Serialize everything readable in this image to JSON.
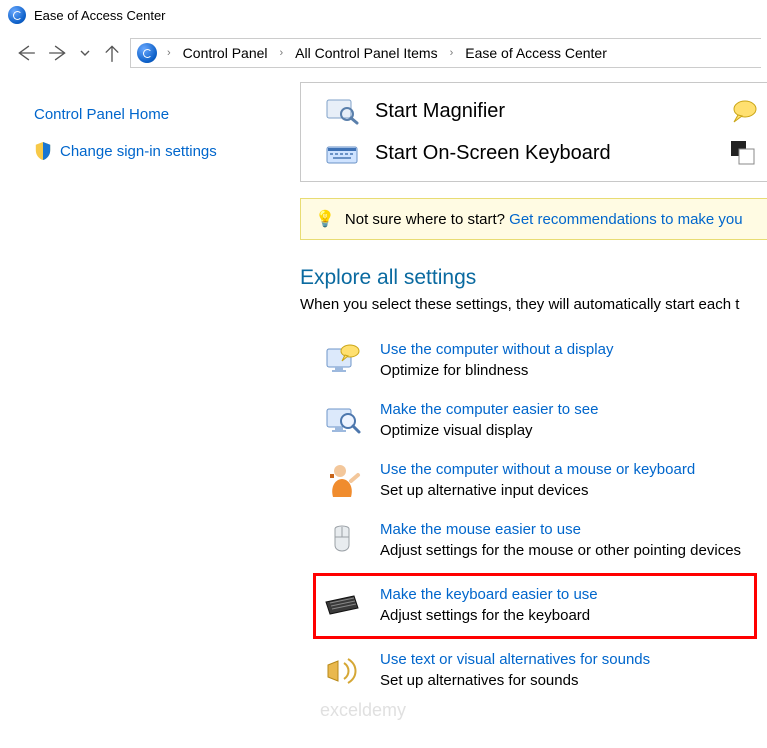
{
  "window_title": "Ease of Access Center",
  "breadcrumb": [
    "Control Panel",
    "All Control Panel Items",
    "Ease of Access Center"
  ],
  "sidebar": {
    "home": "Control Panel Home",
    "signin": "Change sign-in settings"
  },
  "quick": {
    "magnifier": "Start Magnifier",
    "osk": "Start On-Screen Keyboard"
  },
  "info": {
    "lead": "Not sure where to start? ",
    "link": "Get recommendations to make you"
  },
  "explore": {
    "heading": "Explore all settings",
    "sub": "When you select these settings, they will automatically start each t",
    "items": [
      {
        "title": "Use the computer without a display",
        "desc": "Optimize for blindness"
      },
      {
        "title": "Make the computer easier to see",
        "desc": "Optimize visual display"
      },
      {
        "title": "Use the computer without a mouse or keyboard",
        "desc": "Set up alternative input devices"
      },
      {
        "title": "Make the mouse easier to use",
        "desc": "Adjust settings for the mouse or other pointing devices"
      },
      {
        "title": "Make the keyboard easier to use",
        "desc": "Adjust settings for the keyboard"
      },
      {
        "title": "Use text or visual alternatives for sounds",
        "desc": "Set up alternatives for sounds"
      }
    ]
  },
  "watermark": "exceldemy"
}
